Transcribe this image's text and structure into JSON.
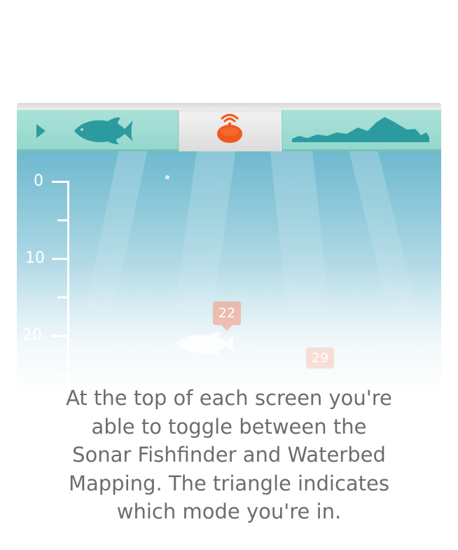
{
  "tabs": {
    "fish_tab": {
      "play_icon": "triangle-right-icon",
      "fish_icon": "fish-icon"
    },
    "center_tab": {
      "icon": "sonar-device-icon",
      "accent": "#f2581c"
    },
    "map_tab": {
      "icon": "waterbed-profile-icon"
    }
  },
  "depth_scale": {
    "labels": [
      "0",
      "10",
      "20"
    ]
  },
  "markers": [
    {
      "label": "22"
    },
    {
      "label": "29"
    }
  ],
  "caption": {
    "line1": "At the top of each screen you're",
    "line2": "able to toggle between the",
    "line3": "Sonar Fishfinder and Waterbed",
    "line4": "Mapping. The triangle indicates",
    "line5": "which mode you're in."
  },
  "colors": {
    "tab_teal": "#a1ddd3",
    "icon_teal": "#2c9ba0",
    "water_top": "#6fb9cf",
    "caption_text": "#6d6d6d"
  }
}
